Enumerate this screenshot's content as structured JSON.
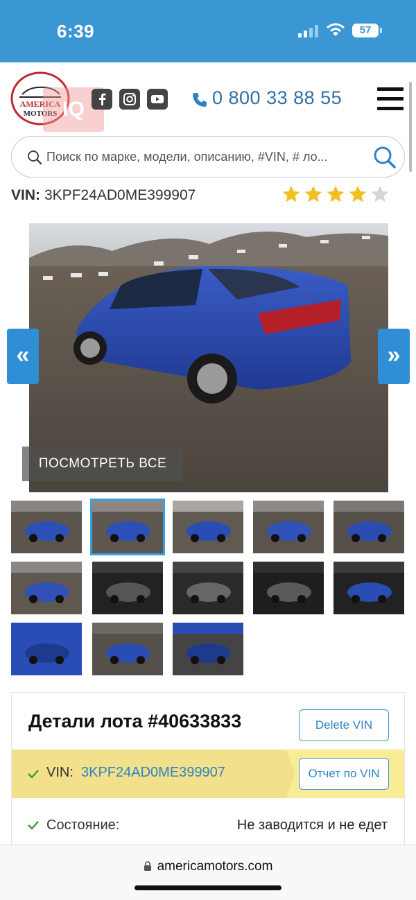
{
  "status_bar": {
    "time": "6:39",
    "battery": "57"
  },
  "header": {
    "logo_text": "AMERICA MOTORS",
    "badge_text": "IQ",
    "phone": "0 800 33 88 55",
    "search_placeholder": "Поиск по марке, модели, описанию, #VIN, # ло...",
    "social": [
      "facebook-icon",
      "instagram-icon",
      "youtube-icon"
    ]
  },
  "vin_row": {
    "label": "VIN:",
    "value": "3KPF24AD0ME399907",
    "rating": 4,
    "rating_max": 5
  },
  "gallery": {
    "view_all": "ПОСМОТРЕТЬ ВСЕ",
    "prev": "«",
    "next": "»",
    "active_thumb": 2,
    "thumb_count": 13
  },
  "details": {
    "title": "Детали лота #40633833",
    "delete_vin": "Delete VIN",
    "vin_label": "VIN:",
    "vin_value": "3KPF24AD0ME399907",
    "vin_report": "Отчет по VIN",
    "condition_label": "Состояние:",
    "condition_value": "Не заводится и не едет"
  },
  "browser": {
    "url": "americamotors.com"
  },
  "colors": {
    "accent": "#3a97d4",
    "link": "#2e82c4",
    "vin_band": "#faeb96"
  }
}
